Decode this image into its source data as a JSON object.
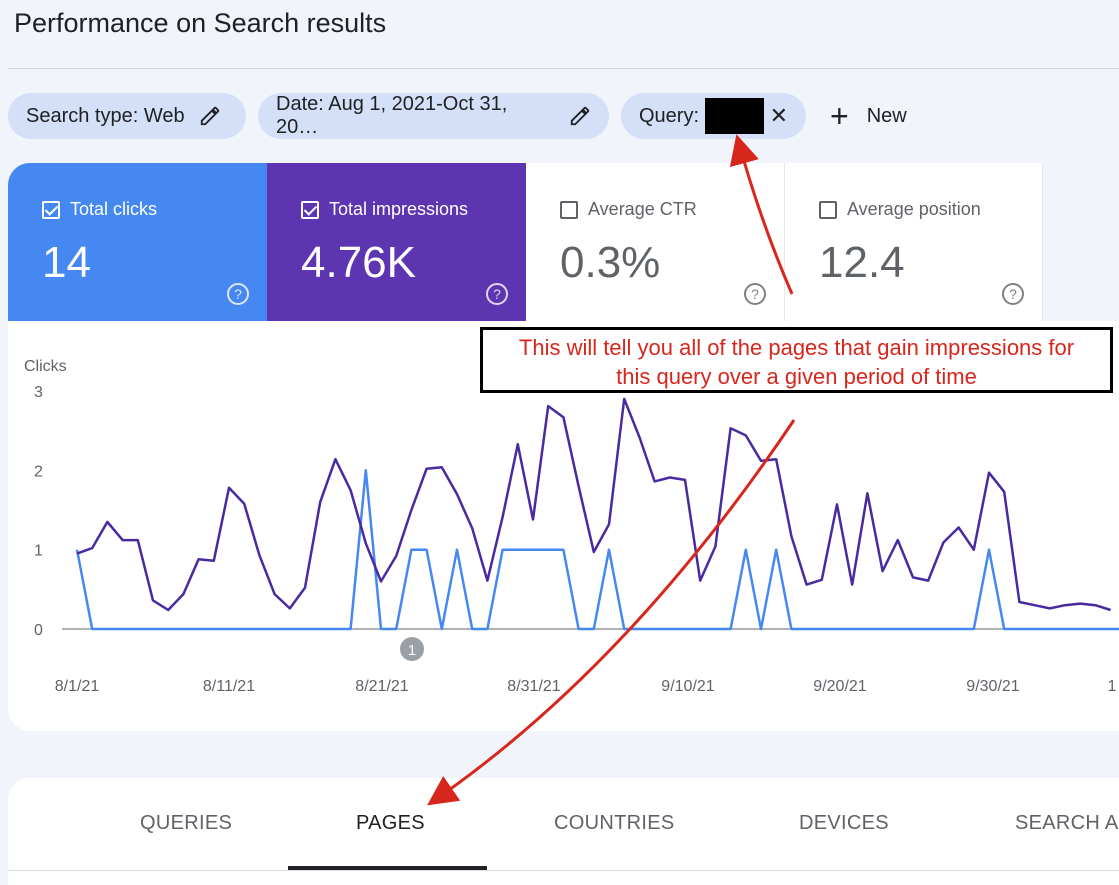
{
  "page": {
    "title": "Performance on Search results"
  },
  "filters": {
    "search_type": "Search type: Web",
    "date": "Date: Aug 1, 2021-Oct 31, 20…",
    "query_label": "Query:",
    "new_label": "New",
    "icons": {
      "edit": "pencil-icon",
      "remove": "close-icon",
      "add": "plus-icon"
    }
  },
  "metrics": [
    {
      "label": "Total clicks",
      "value": "14",
      "checked": true,
      "color": "#4688f1"
    },
    {
      "label": "Total impressions",
      "value": "4.76K",
      "checked": true,
      "color": "#5e35b1"
    },
    {
      "label": "Average CTR",
      "value": "0.3%",
      "checked": false
    },
    {
      "label": "Average position",
      "value": "12.4",
      "checked": false
    }
  ],
  "annotation": {
    "text_line1": "This will tell you all of the pages that gain impressions for",
    "text_line2": "this query over a given period of time",
    "color": "#d7261c"
  },
  "chart_data": {
    "type": "line",
    "ylabel": "Clicks",
    "yticks": [
      "0",
      "1",
      "2",
      "3"
    ],
    "ylim": [
      0,
      3
    ],
    "x_ticks": [
      "8/1/21",
      "8/11/21",
      "8/21/21",
      "8/31/21",
      "9/10/21",
      "9/20/21",
      "9/30/21",
      "1"
    ],
    "marker_label": "1",
    "series": [
      {
        "color": "#4688f1",
        "values": [
          1,
          0,
          0,
          0,
          0,
          0,
          0,
          0,
          0,
          0,
          0,
          0,
          0,
          0,
          0,
          0,
          0,
          0,
          0,
          2,
          0,
          0,
          1,
          1,
          0,
          1,
          0,
          0,
          1,
          1,
          1,
          1,
          1,
          0,
          0,
          1,
          0,
          0,
          0,
          0,
          0,
          0,
          0,
          0,
          1,
          0,
          1,
          0,
          0,
          0,
          0,
          0,
          0,
          0,
          0,
          0,
          0,
          0,
          0,
          0,
          1,
          0,
          0,
          0,
          0,
          0,
          0,
          0,
          0,
          0,
          0,
          0,
          0,
          0
        ]
      },
      {
        "color": "#4a2aa0",
        "values": [
          0.95,
          1.02,
          1.35,
          1.12,
          1.12,
          0.36,
          0.24,
          0.44,
          0.88,
          0.86,
          1.78,
          1.58,
          0.93,
          0.44,
          0.26,
          0.52,
          1.6,
          2.14,
          1.75,
          1.08,
          0.6,
          0.92,
          1.5,
          2.02,
          2.04,
          1.7,
          1.27,
          0.61,
          1.41,
          2.33,
          1.38,
          2.81,
          2.67,
          1.8,
          0.97,
          1.32,
          2.9,
          2.42,
          1.86,
          1.91,
          1.88,
          0.61,
          1.04,
          2.53,
          2.44,
          2.12,
          2.14,
          1.17,
          0.56,
          0.62,
          1.57,
          0.56,
          1.71,
          0.73,
          1.12,
          0.65,
          0.61,
          1.09,
          1.28,
          1.0,
          1.97,
          1.73,
          0.34,
          0.3,
          0.26,
          0.3,
          0.32,
          0.3,
          0.24
        ]
      }
    ]
  },
  "tabs": [
    "QUERIES",
    "PAGES",
    "COUNTRIES",
    "DEVICES",
    "SEARCH AP"
  ]
}
